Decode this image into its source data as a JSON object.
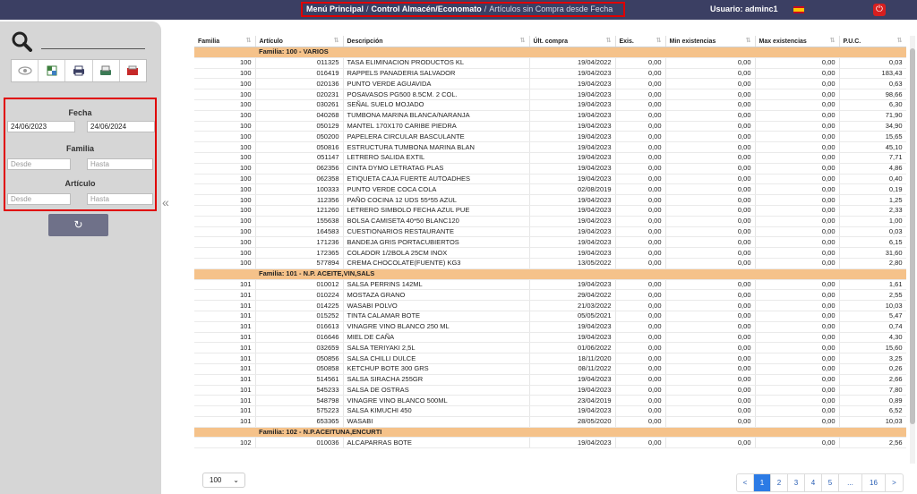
{
  "header": {
    "breadcrumb": [
      "Menú Principal",
      "Control Almacén/Economato",
      "Artículos sin Compra desde Fecha"
    ],
    "user": "Usuario: adminc1",
    "colors": {
      "bar": "#3b3f63",
      "highlight": "#e00000"
    }
  },
  "sidebar": {
    "search_placeholder": "",
    "tools": [
      "eye-icon",
      "spreadsheet-icon",
      "printer-icon",
      "export-icon",
      "pdf-icon"
    ],
    "fecha_label": "Fecha",
    "fecha_desde": "24/06/2023",
    "fecha_hasta": "24/06/2024",
    "familia_label": "Familia",
    "familia_desde_ph": "Desde",
    "familia_hasta_ph": "Hasta",
    "articulo_label": "Artículo",
    "articulo_desde_ph": "Desde",
    "articulo_hasta_ph": "Hasta"
  },
  "table": {
    "columns": [
      "Familia",
      "Artículo",
      "Descripción",
      "Últ. compra",
      "Exis.",
      "Min existencias",
      "Max existencias",
      "P.U.C."
    ],
    "rows": [
      {
        "group": "Familia: 100 - VARIOS"
      },
      [
        "100",
        "011325",
        "TASA ELIMINACION PRODUCTOS KL",
        "19/04/2022",
        "0,00",
        "0,00",
        "0,00",
        "0,03"
      ],
      [
        "100",
        "016419",
        "RAPPELS PANADERIA SALVADOR",
        "19/04/2023",
        "0,00",
        "0,00",
        "0,00",
        "183,43"
      ],
      [
        "100",
        "020136",
        "PUNTO VERDE AGUAVIDA",
        "19/04/2023",
        "0,00",
        "0,00",
        "0,00",
        "0,63"
      ],
      [
        "100",
        "020231",
        "POSAVASOS PG500 8.5CM. 2 COL.",
        "19/04/2023",
        "0,00",
        "0,00",
        "0,00",
        "98,66"
      ],
      [
        "100",
        "030261",
        "SEÑAL SUELO MOJADO",
        "19/04/2023",
        "0,00",
        "0,00",
        "0,00",
        "6,30"
      ],
      [
        "100",
        "040268",
        "TUMBONA MARINA BLANCA/NARANJA",
        "19/04/2023",
        "0,00",
        "0,00",
        "0,00",
        "71,90"
      ],
      [
        "100",
        "050129",
        "MANTEL 170X170 CARIBE PIEDRA",
        "19/04/2023",
        "0,00",
        "0,00",
        "0,00",
        "34,90"
      ],
      [
        "100",
        "050200",
        "PAPELERA CIRCULAR BASCULANTE",
        "19/04/2023",
        "0,00",
        "0,00",
        "0,00",
        "15,65"
      ],
      [
        "100",
        "050816",
        "ESTRUCTURA TUMBONA MARINA BLAN",
        "19/04/2023",
        "0,00",
        "0,00",
        "0,00",
        "45,10"
      ],
      [
        "100",
        "051147",
        "LETRERO SALIDA EXTIL",
        "19/04/2023",
        "0,00",
        "0,00",
        "0,00",
        "7,71"
      ],
      [
        "100",
        "062356",
        "CINTA DYMO LETRATAG PLAS",
        "19/04/2023",
        "0,00",
        "0,00",
        "0,00",
        "4,86"
      ],
      [
        "100",
        "062358",
        "ETIQUETA CAJA FUERTE AUTOADHES",
        "19/04/2023",
        "0,00",
        "0,00",
        "0,00",
        "0,40"
      ],
      [
        "100",
        "100333",
        "PUNTO VERDE COCA COLA",
        "02/08/2019",
        "0,00",
        "0,00",
        "0,00",
        "0,19"
      ],
      [
        "100",
        "112356",
        "PAÑO COCINA 12 UDS 55*55 AZUL",
        "19/04/2023",
        "0,00",
        "0,00",
        "0,00",
        "1,25"
      ],
      [
        "100",
        "121260",
        "LETRERO SIMBOLO FECHA AZUL PUE",
        "19/04/2023",
        "0,00",
        "0,00",
        "0,00",
        "2,33"
      ],
      [
        "100",
        "155638",
        "BOLSA CAMISETA 40*50 BLANC120",
        "19/04/2023",
        "0,00",
        "0,00",
        "0,00",
        "1,00"
      ],
      [
        "100",
        "164583",
        "CUESTIONARIOS RESTAURANTE",
        "19/04/2023",
        "0,00",
        "0,00",
        "0,00",
        "0,03"
      ],
      [
        "100",
        "171236",
        "BANDEJA GRIS PORTACUBIERTOS",
        "19/04/2023",
        "0,00",
        "0,00",
        "0,00",
        "6,15"
      ],
      [
        "100",
        "172365",
        "COLADOR 1/2BOLA 25CM INOX",
        "19/04/2023",
        "0,00",
        "0,00",
        "0,00",
        "31,60"
      ],
      [
        "100",
        "577894",
        "CREMA CHOCOLATE(FUENTE) KG3",
        "13/05/2022",
        "0,00",
        "0,00",
        "0,00",
        "2,80"
      ],
      {
        "group": "Familia: 101 - N.P. ACEITE,VIN,SALS"
      },
      [
        "101",
        "010012",
        "SALSA PERRINS 142ML",
        "19/04/2023",
        "0,00",
        "0,00",
        "0,00",
        "1,61"
      ],
      [
        "101",
        "010224",
        "MOSTAZA GRANO",
        "29/04/2022",
        "0,00",
        "0,00",
        "0,00",
        "2,55"
      ],
      [
        "101",
        "014225",
        "WASABI POLVO",
        "21/03/2022",
        "0,00",
        "0,00",
        "0,00",
        "10,03"
      ],
      [
        "101",
        "015252",
        "TINTA CALAMAR BOTE",
        "05/05/2021",
        "0,00",
        "0,00",
        "0,00",
        "5,47"
      ],
      [
        "101",
        "016613",
        "VINAGRE VINO BLANCO 250 ML",
        "19/04/2023",
        "0,00",
        "0,00",
        "0,00",
        "0,74"
      ],
      [
        "101",
        "016646",
        "MIEL DE CAÑA",
        "19/04/2023",
        "0,00",
        "0,00",
        "0,00",
        "4,30"
      ],
      [
        "101",
        "032659",
        "SALSA TERIYAKI 2,5L",
        "01/06/2022",
        "0,00",
        "0,00",
        "0,00",
        "15,60"
      ],
      [
        "101",
        "050856",
        "SALSA CHILLI DULCE",
        "18/11/2020",
        "0,00",
        "0,00",
        "0,00",
        "3,25"
      ],
      [
        "101",
        "050858",
        "KETCHUP BOTE 300 GRS",
        "08/11/2022",
        "0,00",
        "0,00",
        "0,00",
        "0,26"
      ],
      [
        "101",
        "514561",
        "SALSA SIRACHA 255GR",
        "19/04/2023",
        "0,00",
        "0,00",
        "0,00",
        "2,66"
      ],
      [
        "101",
        "545233",
        "SALSA DE OSTRAS",
        "19/04/2023",
        "0,00",
        "0,00",
        "0,00",
        "7,80"
      ],
      [
        "101",
        "548798",
        "VINAGRE VINO BLANCO 500ML",
        "23/04/2019",
        "0,00",
        "0,00",
        "0,00",
        "0,89"
      ],
      [
        "101",
        "575223",
        "SALSA KIMUCHI 450",
        "19/04/2023",
        "0,00",
        "0,00",
        "0,00",
        "6,52"
      ],
      [
        "101",
        "653365",
        "WASABI",
        "28/05/2020",
        "0,00",
        "0,00",
        "0,00",
        "10,03"
      ],
      {
        "group": "Familia: 102 - N.P.ACEITUNA,ENCURTI"
      },
      [
        "102",
        "010036",
        "ALCAPARRAS BOTE",
        "19/04/2023",
        "0,00",
        "0,00",
        "0,00",
        "2,56"
      ]
    ]
  },
  "footer": {
    "page_size": "100",
    "pages": [
      "<",
      "1",
      "2",
      "3",
      "4",
      "5",
      "...",
      "16",
      ">"
    ],
    "active_page": "1"
  }
}
